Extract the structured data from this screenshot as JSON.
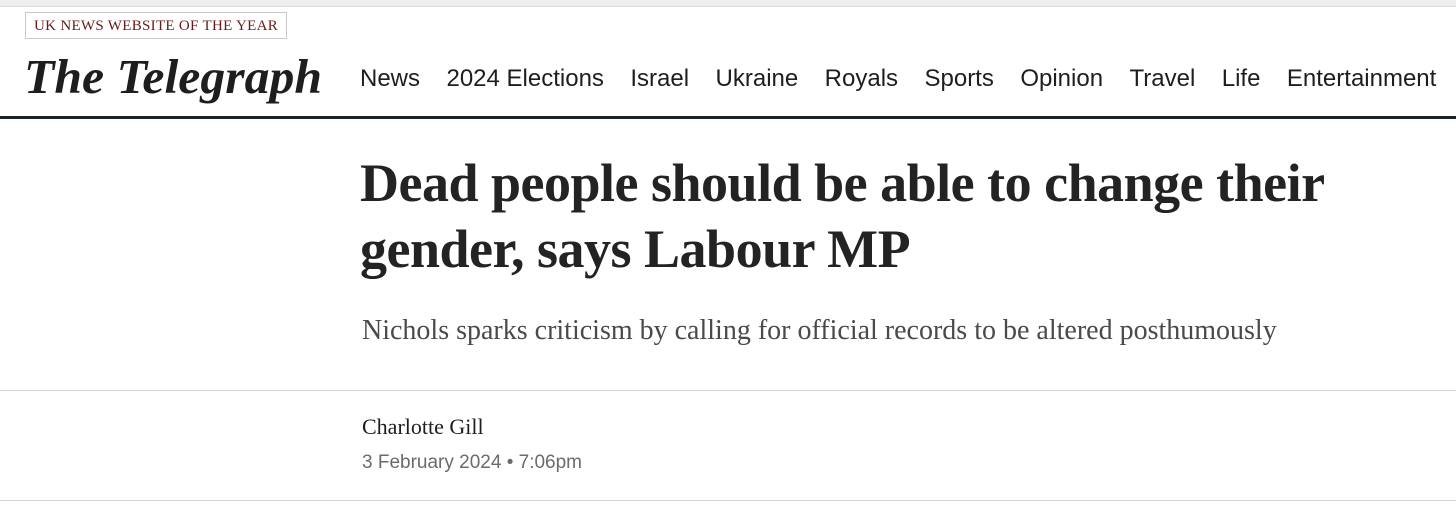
{
  "header": {
    "award": "UK NEWS WEBSITE OF THE YEAR",
    "logo_text": "The Telegraph"
  },
  "nav": {
    "items": [
      {
        "label": "News"
      },
      {
        "label": "2024 Elections"
      },
      {
        "label": "Israel"
      },
      {
        "label": "Ukraine"
      },
      {
        "label": "Royals"
      },
      {
        "label": "Sports"
      },
      {
        "label": "Opinion"
      },
      {
        "label": "Travel"
      },
      {
        "label": "Life"
      },
      {
        "label": "Entertainment"
      }
    ]
  },
  "article": {
    "headline": "Dead people should be able to change their gender, says Labour MP",
    "standfirst": "Nichols sparks criticism by calling for official records to be altered posthumously",
    "author": "Charlotte Gill",
    "date": "3 February 2024",
    "separator": "•",
    "time": "7:06pm"
  }
}
